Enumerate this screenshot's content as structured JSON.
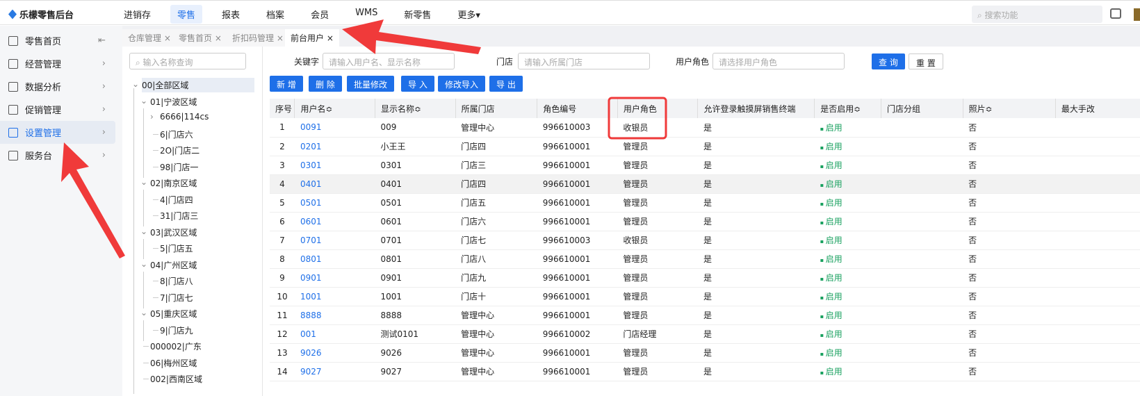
{
  "app": {
    "title": "乐檬零售后台"
  },
  "nav": [
    "进销存",
    "零售",
    "报表",
    "档案",
    "会员",
    "WMS",
    "新零售",
    "更多▾"
  ],
  "search": {
    "placeholder": "搜索功能"
  },
  "sidebar": [
    {
      "label": "零售首页",
      "icon": "home-icon"
    },
    {
      "label": "经营管理",
      "icon": "monitor-icon"
    },
    {
      "label": "数据分析",
      "icon": "chart-icon"
    },
    {
      "label": "促销管理",
      "icon": "promo-icon"
    },
    {
      "label": "设置管理",
      "icon": "folder-icon"
    },
    {
      "label": "服务台",
      "icon": "cube-icon"
    }
  ],
  "tabs": [
    "仓库管理 ×",
    "零售首页 ×",
    "折扣码管理 ×",
    "前台用户 ×"
  ],
  "tree": {
    "placeholder": "输入名称查询",
    "nodes": [
      "00|全部区域",
      "01|宁波区域",
      "6666|114cs",
      "6|门店六",
      "2O|门店二",
      "98|门店一",
      "02|南京区域",
      "4|门店四",
      "31|门店三",
      "03|武汉区域",
      "5|门店五",
      "04|广州区域",
      "8|门店八",
      "7|门店七",
      "05|重庆区域",
      "9|门店九",
      "000002|广东",
      "06|梅州区域",
      "002|西南区域"
    ]
  },
  "filters": {
    "keyword_label": "关键字",
    "keyword_placeholder": "请输入用户名、显示名称",
    "store_label": "门店",
    "store_placeholder": "请输入所属门店",
    "role_label": "用户角色",
    "role_placeholder": "请选择用户角色",
    "query": "查 询",
    "reset": "重 置"
  },
  "actions": [
    "新 增",
    "删 除",
    "批量修改",
    "导 入",
    "修改导入",
    "导 出"
  ],
  "table": {
    "headers": [
      "序号",
      "用户名≎",
      "显示名称≎",
      "所属门店",
      "角色编号",
      "用户角色",
      "允许登录触摸屏销售终端",
      "是否启用≎",
      "门店分组",
      "照片≎",
      "最大手改"
    ],
    "rows": [
      [
        "1",
        "0091",
        "009",
        "管理中心",
        "996610003",
        "收银员",
        "是",
        "启用",
        "",
        "否"
      ],
      [
        "2",
        "0201",
        "小王王",
        "门店四",
        "996610001",
        "管理员",
        "是",
        "启用",
        "",
        "否"
      ],
      [
        "3",
        "0301",
        "0301",
        "门店三",
        "996610001",
        "管理员",
        "是",
        "启用",
        "",
        "否"
      ],
      [
        "4",
        "0401",
        "0401",
        "门店四",
        "996610001",
        "管理员",
        "是",
        "启用",
        "",
        "否"
      ],
      [
        "5",
        "0501",
        "0501",
        "门店五",
        "996610001",
        "管理员",
        "是",
        "启用",
        "",
        "否"
      ],
      [
        "6",
        "0601",
        "0601",
        "门店六",
        "996610001",
        "管理员",
        "是",
        "启用",
        "",
        "否"
      ],
      [
        "7",
        "0701",
        "0701",
        "门店七",
        "996610003",
        "收银员",
        "是",
        "启用",
        "",
        "否"
      ],
      [
        "8",
        "0801",
        "0801",
        "门店八",
        "996610001",
        "管理员",
        "是",
        "启用",
        "",
        "否"
      ],
      [
        "9",
        "0901",
        "0901",
        "门店九",
        "996610001",
        "管理员",
        "是",
        "启用",
        "",
        "否"
      ],
      [
        "10",
        "1001",
        "1001",
        "门店十",
        "996610001",
        "管理员",
        "是",
        "启用",
        "",
        "否"
      ],
      [
        "11",
        "8888",
        "8888",
        "管理中心",
        "996610001",
        "管理员",
        "是",
        "启用",
        "",
        "否"
      ],
      [
        "12",
        "001",
        "测试0101",
        "管理中心",
        "996610002",
        "门店经理",
        "是",
        "启用",
        "",
        "否"
      ],
      [
        "13",
        "9026",
        "9026",
        "管理中心",
        "996610001",
        "管理员",
        "是",
        "启用",
        "",
        "否"
      ],
      [
        "14",
        "9027",
        "9027",
        "管理中心",
        "996610001",
        "管理员",
        "是",
        "启用",
        "",
        "否"
      ]
    ]
  },
  "colors": {
    "accent": "#1e6fe8",
    "annotation": "#f03a3a",
    "enabled": "#19a15f"
  }
}
